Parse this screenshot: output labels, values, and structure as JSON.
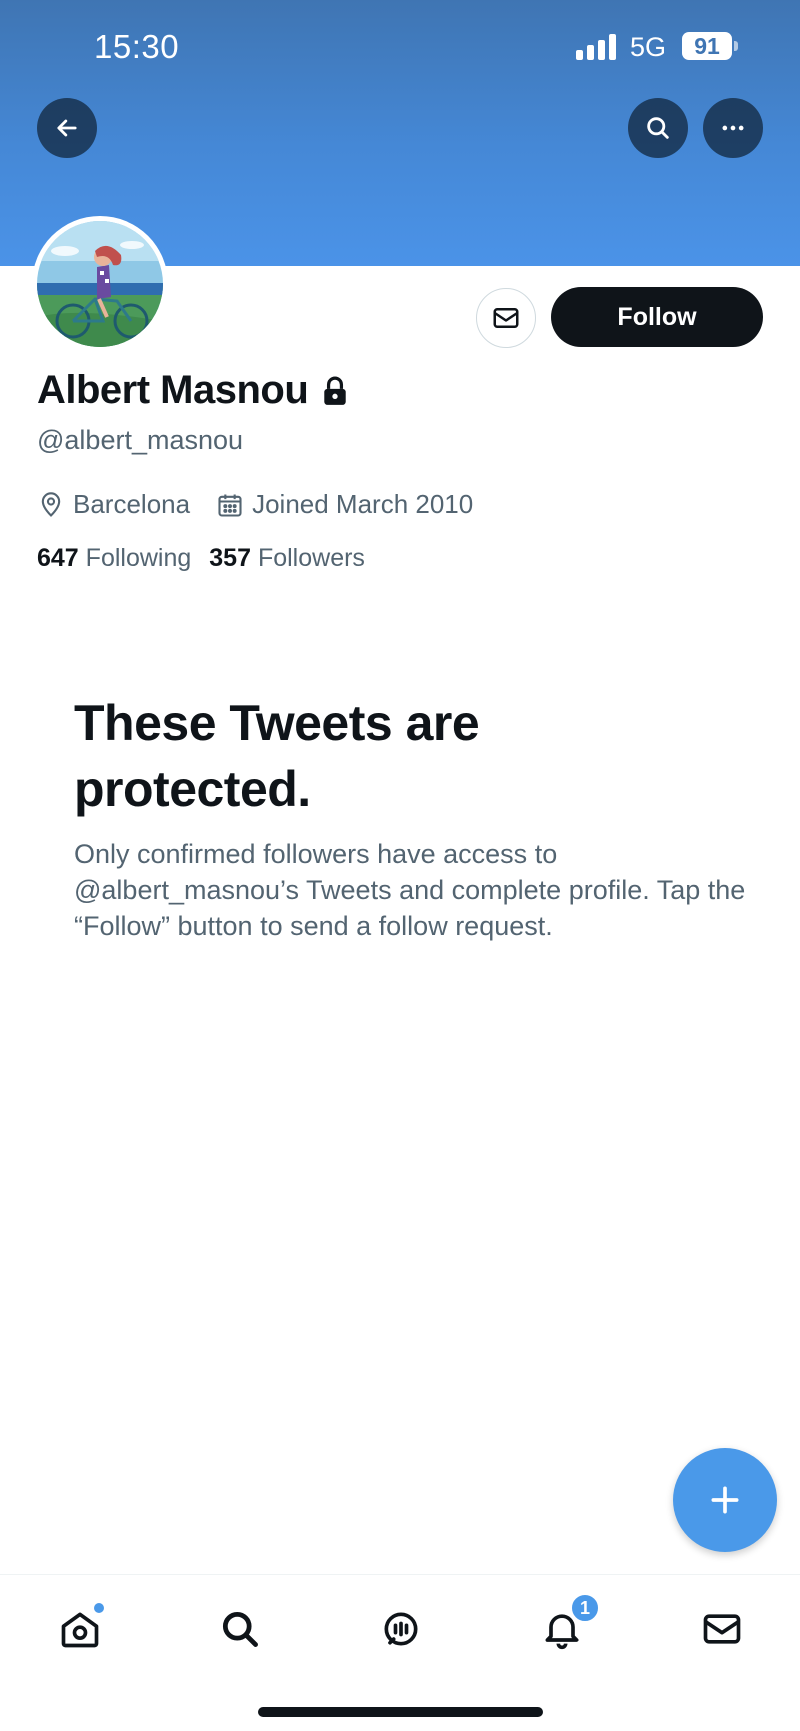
{
  "status_bar": {
    "time": "15:30",
    "network": "5G",
    "battery": "91"
  },
  "header": {
    "back_icon": "arrow-left-icon",
    "search_icon": "search-icon",
    "more_icon": "more-horizontal-icon",
    "banner_color": "#4588d6"
  },
  "profile": {
    "name": "Albert Masnou",
    "handle": "@albert_masnou",
    "protected_icon": "lock-icon",
    "location": "Barcelona",
    "joined": "Joined March 2010",
    "following_count": "647",
    "following_label": "Following",
    "followers_count": "357",
    "followers_label": "Followers"
  },
  "actions": {
    "message_icon": "envelope-icon",
    "follow_label": "Follow"
  },
  "protected_notice": {
    "title": "These Tweets are protected.",
    "body": "Only confirmed followers have access to @albert_masnou’s Tweets and complete profile. Tap the “Follow” button to send a follow request."
  },
  "fab": {
    "icon": "plus-icon",
    "color": "#4a99e9"
  },
  "tabbar": {
    "items": [
      {
        "name": "home",
        "icon": "home-icon",
        "has_dot": true
      },
      {
        "name": "search",
        "icon": "search-icon"
      },
      {
        "name": "spaces",
        "icon": "spaces-icon"
      },
      {
        "name": "notifications",
        "icon": "bell-icon",
        "badge": "1"
      },
      {
        "name": "messages",
        "icon": "envelope-icon"
      }
    ]
  }
}
